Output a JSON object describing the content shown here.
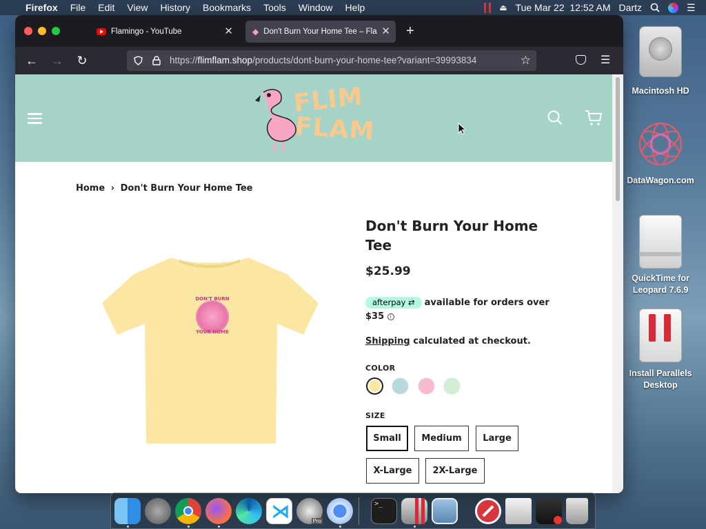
{
  "menubar": {
    "app_name": "Firefox",
    "menus": [
      "File",
      "Edit",
      "View",
      "History",
      "Bookmarks",
      "Tools",
      "Window",
      "Help"
    ],
    "clock": "Tue Mar 22  12:52 AM",
    "user": "Dartz"
  },
  "desktop": {
    "icons": [
      {
        "label": "Macintosh HD",
        "icon": "hard-drive-icon"
      },
      {
        "label": "DataWagon.com",
        "icon": "datawagon-icon"
      },
      {
        "label": "QuickTime for Leopard 7.6.9",
        "icon": "disk-image-icon"
      },
      {
        "label": "Install Parallels Desktop",
        "icon": "parallels-icon"
      }
    ]
  },
  "browser": {
    "tabs": [
      {
        "title": "Flamingo - YouTube",
        "favicon": "youtube-icon",
        "active": false
      },
      {
        "title": "Don't Burn Your Home Tee – Fla",
        "favicon": "flamingo-icon",
        "active": true
      }
    ],
    "url_prefix": "https://",
    "url_domain": "flimflam.shop",
    "url_path": "/products/dont-burn-your-home-tee?variant=39993834",
    "colors": {
      "tabbar": "#1c1b22",
      "navbar": "#2b2a33",
      "urlbar": "#42414d"
    }
  },
  "site": {
    "logo_line1": "FLIM",
    "logo_line2": "FLAM",
    "header_color": "#a6d3c8",
    "breadcrumb_home": "Home",
    "breadcrumb_sep": "›",
    "breadcrumb_current": "Don't Burn Your Home Tee",
    "product": {
      "title": "Don't Burn Your Home Tee",
      "price": "$25.99",
      "afterpay_badge": "afterpay",
      "afterpay_text": "available for orders over",
      "afterpay_amount": "$35",
      "shipping_link": "Shipping",
      "shipping_text": "calculated at checkout.",
      "shirt_print_top": "DON'T BURN",
      "shirt_print_bottom": "YOUR HOME",
      "color_label": "COLOR",
      "colors": [
        {
          "name": "yellow",
          "hex": "#fbe7a0",
          "selected": true
        },
        {
          "name": "blue",
          "hex": "#b7d8dd",
          "selected": false
        },
        {
          "name": "pink",
          "hex": "#f7bccb",
          "selected": false
        },
        {
          "name": "green",
          "hex": "#d3ecd6",
          "selected": false
        }
      ],
      "size_label": "SIZE",
      "sizes": [
        "Small",
        "Medium",
        "Large",
        "X-Large",
        "2X-Large"
      ],
      "selected_size": "Small"
    }
  },
  "dock": {
    "apps": [
      "Finder",
      "Launchpad",
      "Chrome",
      "Firefox",
      "Edge",
      "VS Code",
      "Pro",
      "Chromium",
      "Terminal",
      "Parallels",
      "Preview",
      "Blocker",
      "Archive",
      "Utility",
      "Trash"
    ]
  }
}
